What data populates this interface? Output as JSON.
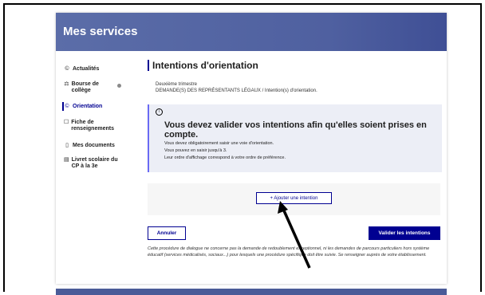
{
  "header": {
    "title": "Mes services"
  },
  "sidebar": {
    "items": [
      {
        "icon": "©",
        "label": "Actualités"
      },
      {
        "icon": "⚖",
        "label": "Bourse de collège"
      },
      {
        "icon": "©",
        "label": "Orientation"
      },
      {
        "icon": "☐",
        "label": "Fiche de renseignements"
      },
      {
        "icon": "▯",
        "label": "Mes documents"
      },
      {
        "icon": "▤",
        "label": "Livret scolaire du CP à la 3e"
      }
    ]
  },
  "main": {
    "title": "Intentions d'orientation",
    "trimester": "Deuxième trimestre",
    "breadcrumb": "DEMANDE(S) DES REPRÉSENTANTS LÉGAUX / Intention(s) d'orientation.",
    "info": {
      "icon": "i",
      "heading": "Vous devez valider vos intentions afin qu'elles soient prises en compte.",
      "lines": [
        "Vous devez obligatoirement saisir une voie d'orientation.",
        "Vous pouvez en saisir jusqu'à 3.",
        "Leur ordre d'affichage correspond à votre ordre de préférence."
      ]
    },
    "add_button": "+ Ajouter une intention",
    "cancel_button": "Annuler",
    "validate_button": "Valider les intentions",
    "note": "Cette procédure de dialogue ne concerne pas la demande de redoublement exceptionnel, ni les demandes de parcours particuliers hors système éducatif (services médicalisés, sociaux...) pour lesquels une procédure spécifique doit être suivie. Se renseigner auprès de votre établissement."
  },
  "colors": {
    "primary": "#000091",
    "banner": "#4f60a0",
    "info_bg": "#eceef6"
  }
}
